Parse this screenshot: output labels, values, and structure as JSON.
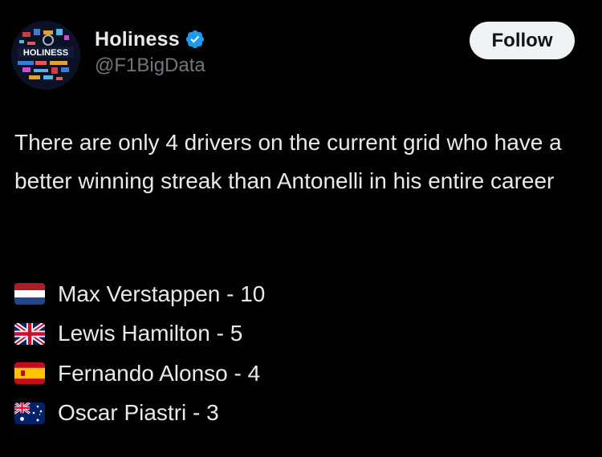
{
  "post": {
    "author": {
      "display_name": "Holiness",
      "handle": "@F1BigData",
      "verified": true,
      "avatar_text": "HOLINESS",
      "verified_color": "#1d9bf0"
    },
    "follow_label": "Follow",
    "text": "There are only 4 drivers on the current grid who have a better winning streak than Antonelli in his entire career",
    "drivers": [
      {
        "flag": "netherlands-flag",
        "text": "Max Verstappen - 10"
      },
      {
        "flag": "uk-flag",
        "text": "Lewis Hamilton - 5"
      },
      {
        "flag": "spain-flag",
        "text": "Fernando Alonso - 4"
      },
      {
        "flag": "australia-flag",
        "text": "Oscar Piastri - 3"
      }
    ]
  }
}
